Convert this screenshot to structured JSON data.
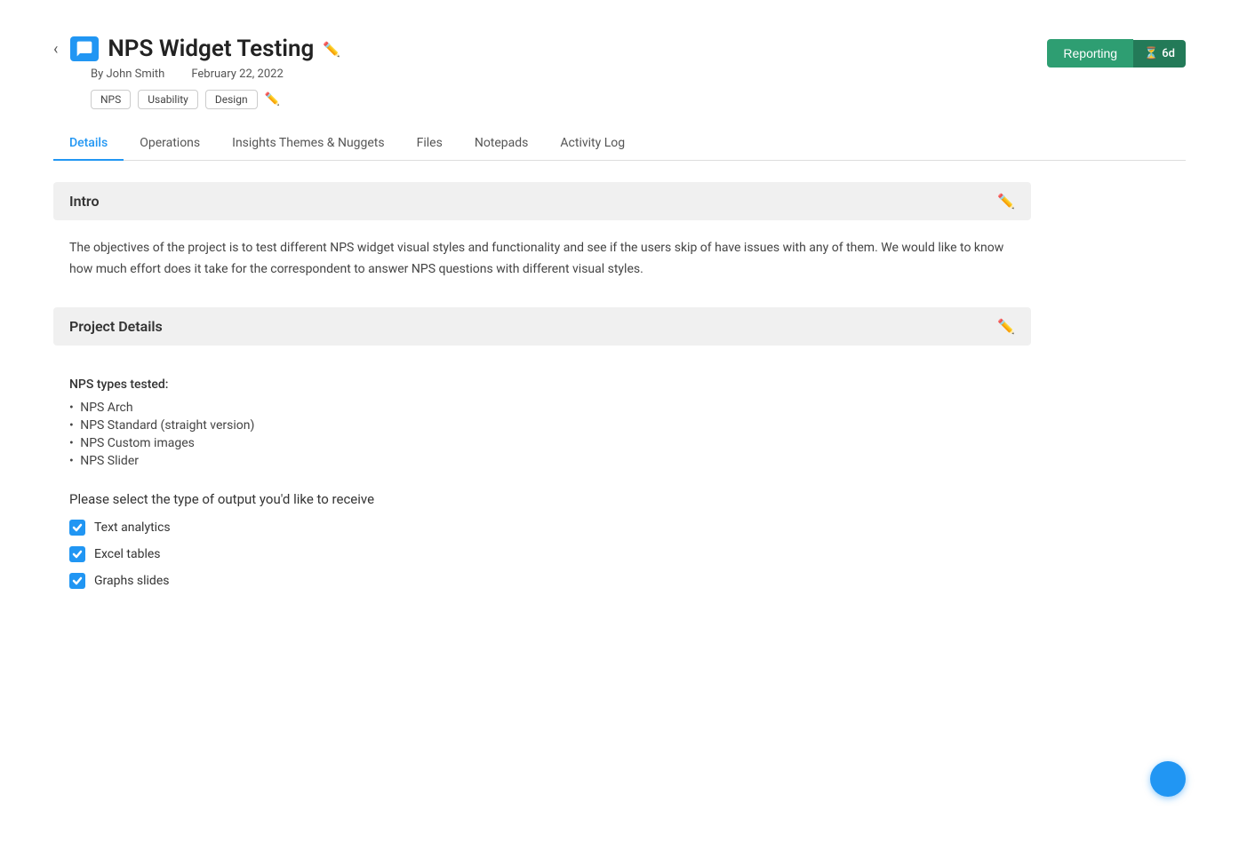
{
  "header": {
    "back_label": "<",
    "title": "NPS Widget Testing",
    "author_prefix": "By",
    "author": "John Smith",
    "date": "February 22, 2022",
    "tags": [
      "NPS",
      "Usability",
      "Design"
    ],
    "reporting_btn": "Reporting",
    "time_badge": "6d"
  },
  "tabs": [
    {
      "label": "Details",
      "active": true
    },
    {
      "label": "Operations",
      "active": false
    },
    {
      "label": "Insights Themes & Nuggets",
      "active": false
    },
    {
      "label": "Files",
      "active": false
    },
    {
      "label": "Notepads",
      "active": false
    },
    {
      "label": "Activity Log",
      "active": false
    }
  ],
  "intro_section": {
    "title": "Intro",
    "content": "The objectives of the project is to test different NPS widget visual styles and functionality and see if the users skip of have issues with any of them. We would like to know how much effort does it take for the correspondent to answer NPS questions with different visual styles."
  },
  "project_details_section": {
    "title": "Project Details",
    "nps_types_label": "NPS types tested:",
    "nps_types": [
      "NPS Arch",
      "NPS Standard (straight version)",
      "NPS Custom images",
      "NPS Slider"
    ],
    "output_label": "Please select the type of output you'd like to receive",
    "checkboxes": [
      {
        "label": "Text analytics",
        "checked": true
      },
      {
        "label": "Excel tables",
        "checked": true
      },
      {
        "label": "Graphs slides",
        "checked": true
      }
    ]
  }
}
